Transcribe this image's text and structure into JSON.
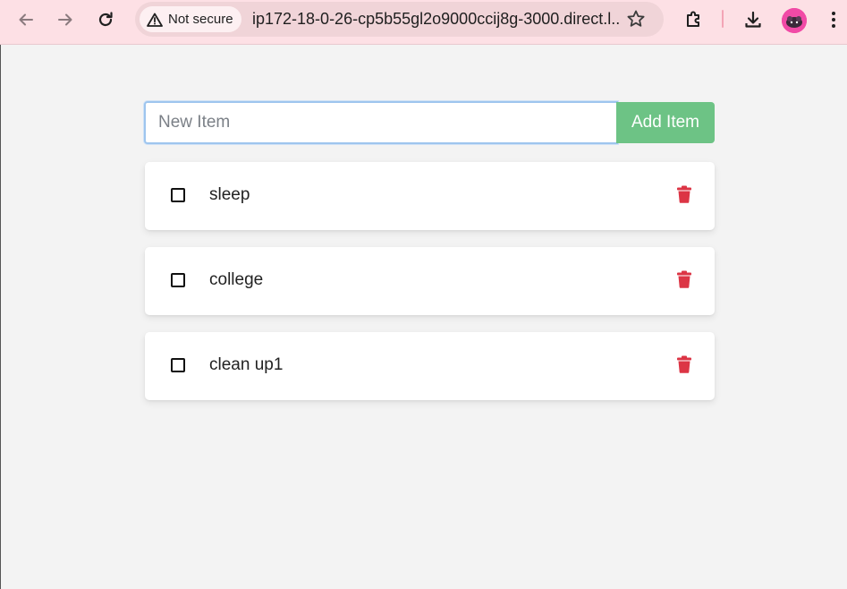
{
  "browser": {
    "security_label": "Not secure",
    "url": "ip172-18-0-26-cp5b55gl2o9000ccij8g-3000.direct.l..."
  },
  "form": {
    "placeholder": "New Item",
    "value": "",
    "add_label": "Add Item"
  },
  "colors": {
    "accent_green": "#6dc385",
    "delete_red": "#dc3545",
    "browser_bar": "#fde0e5"
  },
  "items": [
    {
      "label": "sleep",
      "checked": false
    },
    {
      "label": "college",
      "checked": false
    },
    {
      "label": "clean up1",
      "checked": false
    }
  ]
}
